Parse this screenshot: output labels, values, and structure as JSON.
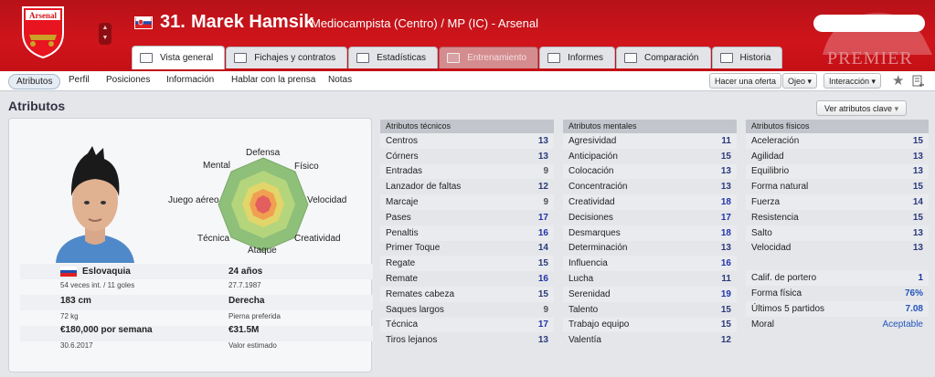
{
  "header": {
    "number": "31.",
    "name": "Marek Hamsik",
    "subtitle": "Mediocampista (Centro) / MP (IC) - Arsenal",
    "club_crest_text": "Arsenal",
    "league_text": "PREMIER",
    "colors": {
      "primary": "#d0141b",
      "disabled_tab": "#d48c8f",
      "link": "#2233aa"
    }
  },
  "search": {
    "value": "",
    "icon": "search-icon"
  },
  "tabs": [
    {
      "label": "Vista general",
      "active": true
    },
    {
      "label": "Fichajes y contratos"
    },
    {
      "label": "Estadísticas"
    },
    {
      "label": "Entrenamiento",
      "disabled": true
    },
    {
      "label": "Informes"
    },
    {
      "label": "Comparación"
    },
    {
      "label": "Historia"
    }
  ],
  "subnav": {
    "items": [
      "Atributos",
      "Perfil",
      "Posiciones",
      "Información",
      "Hablar con la prensa",
      "Notas"
    ],
    "make_offer": "Hacer una oferta",
    "scout": "Ojeo",
    "interaction": "Interacción"
  },
  "section": {
    "title": "Atributos",
    "key_button": "Ver atributos clave"
  },
  "radar": {
    "labels": {
      "top": "Defensa",
      "top_right": "Físico",
      "right": "Velocidad",
      "bottom_right": "Creatividad",
      "bottom": "Ataque",
      "bottom_left": "Técnica",
      "left": "Juego aéreo",
      "top_left": "Mental"
    }
  },
  "info": {
    "nation": "Eslovaquia",
    "caps": "54 veces int. / 11 goles",
    "age": "24 años",
    "dob": "27.7.1987",
    "height": "183 cm",
    "weight": "72 kg",
    "foot": "Derecha",
    "foot_label": "Pierna preferida",
    "wage": "€180,000 por semana",
    "contract": "30.6.2017",
    "value": "€31.5M",
    "value_label": "Valor estimado"
  },
  "technical": {
    "title": "Atributos técnicos",
    "rows": [
      [
        "Centros",
        "13"
      ],
      [
        "Córners",
        "13"
      ],
      [
        "Entradas",
        "9"
      ],
      [
        "Lanzador de faltas",
        "12"
      ],
      [
        "Marcaje",
        "9"
      ],
      [
        "Pases",
        "17"
      ],
      [
        "Penaltis",
        "16"
      ],
      [
        "Primer Toque",
        "14"
      ],
      [
        "Regate",
        "15"
      ],
      [
        "Remate",
        "16"
      ],
      [
        "Remates cabeza",
        "15"
      ],
      [
        "Saques largos",
        "9"
      ],
      [
        "Técnica",
        "17"
      ],
      [
        "Tiros lejanos",
        "13"
      ]
    ]
  },
  "mental": {
    "title": "Atributos mentales",
    "rows": [
      [
        "Agresividad",
        "11"
      ],
      [
        "Anticipación",
        "15"
      ],
      [
        "Colocación",
        "13"
      ],
      [
        "Concentración",
        "13"
      ],
      [
        "Creatividad",
        "18"
      ],
      [
        "Decisiones",
        "17"
      ],
      [
        "Desmarques",
        "18"
      ],
      [
        "Determinación",
        "13"
      ],
      [
        "Influencia",
        "16"
      ],
      [
        "Lucha",
        "11"
      ],
      [
        "Serenidad",
        "19"
      ],
      [
        "Talento",
        "15"
      ],
      [
        "Trabajo equipo",
        "15"
      ],
      [
        "Valentía",
        "12"
      ]
    ]
  },
  "physical": {
    "title": "Atributos físicos",
    "rows": [
      [
        "Aceleración",
        "15"
      ],
      [
        "Agilidad",
        "13"
      ],
      [
        "Equilibrio",
        "13"
      ],
      [
        "Forma natural",
        "15"
      ],
      [
        "Fuerza",
        "14"
      ],
      [
        "Resistencia",
        "15"
      ],
      [
        "Salto",
        "13"
      ],
      [
        "Velocidad",
        "13"
      ]
    ]
  },
  "extra": {
    "rows": [
      [
        "Calif. de portero",
        "1"
      ],
      [
        "Forma física",
        "76%"
      ],
      [
        "Últimos 5 partidos",
        "7.08"
      ],
      [
        "Moral",
        "Aceptable"
      ]
    ]
  }
}
